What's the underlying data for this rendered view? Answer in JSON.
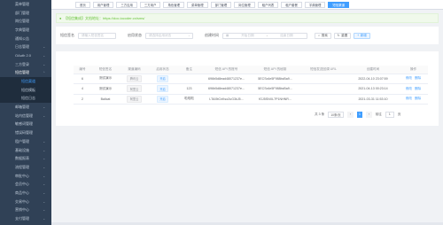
{
  "sidebar": {
    "items": [
      {
        "label": "菜单管理",
        "kind": "item"
      },
      {
        "label": "部门管理",
        "kind": "item"
      },
      {
        "label": "岗位管理",
        "kind": "item"
      },
      {
        "label": "字典管理",
        "kind": "item"
      },
      {
        "label": "通知公告",
        "kind": "item"
      },
      {
        "label": "日志管理",
        "kind": "group"
      },
      {
        "label": "OAuth 2.0",
        "kind": "group"
      },
      {
        "label": "三方登录",
        "kind": "group"
      },
      {
        "label": "短信管理",
        "kind": "group-open"
      },
      {
        "label": "短信渠道",
        "kind": "sub-active"
      },
      {
        "label": "短信模板",
        "kind": "sub"
      },
      {
        "label": "短信日志",
        "kind": "sub"
      },
      {
        "label": "邮箱管理",
        "kind": "group"
      },
      {
        "label": "站内信管理",
        "kind": "group"
      },
      {
        "label": "敏感词管理",
        "kind": "item"
      },
      {
        "label": "错误码管理",
        "kind": "item"
      },
      {
        "label": "租户管理",
        "kind": "group"
      },
      {
        "label": "基础设施",
        "kind": "group"
      },
      {
        "label": "数据报表",
        "kind": "group"
      },
      {
        "label": "流程管理",
        "kind": "group"
      },
      {
        "label": "审批中心",
        "kind": "group"
      },
      {
        "label": "会员中心",
        "kind": "group"
      },
      {
        "label": "商品中心",
        "kind": "group"
      },
      {
        "label": "交易中心",
        "kind": "group"
      },
      {
        "label": "营销中心",
        "kind": "group"
      },
      {
        "label": "支付管理",
        "kind": "group"
      }
    ]
  },
  "tabs": [
    {
      "label": "首页",
      "active": false
    },
    {
      "label": "用户管理",
      "active": false
    },
    {
      "label": "三方应用",
      "active": false
    },
    {
      "label": "三方用户",
      "active": false
    },
    {
      "label": "角色管理",
      "active": false
    },
    {
      "label": "菜单管理",
      "active": false
    },
    {
      "label": "部门管理",
      "active": false
    },
    {
      "label": "岗位管理",
      "active": false
    },
    {
      "label": "租户列表",
      "active": false
    },
    {
      "label": "租户套餐",
      "active": false
    },
    {
      "label": "字典管理",
      "active": false
    },
    {
      "label": "短信渠道",
      "active": true
    }
  ],
  "alert": {
    "text": "【短信集成】文档地址：https://doc.iocoder.cn/sms/"
  },
  "search": {
    "signature_label": "短信签名",
    "signature_placeholder": "请输入短信签名",
    "status_label": "启用状态",
    "status_placeholder": "请选择启用状态",
    "time_label": "创建时间",
    "time_start_placeholder": "开始日期",
    "time_separator": "-",
    "time_end_placeholder": "结束日期",
    "search_button": "搜索",
    "reset_button": "重置",
    "add_button": "新增"
  },
  "table": {
    "headers": [
      "编号",
      "短信签名",
      "渠道编码",
      "启用状态",
      "备注",
      "短信 API 的账号",
      "短信 API 的秘钥",
      "短信发送回调 URL",
      "创建时间",
      "操作"
    ],
    "rows": [
      {
        "id": "6",
        "signature": "测试演示",
        "channel": "腾讯云",
        "status": "开启",
        "remark": "",
        "api_key": "696b5d8ead48071237e...",
        "api_secret": "5ECSx4e5F988bcBa9...",
        "callback": "",
        "created": "2022-04-10 23:07:59"
      },
      {
        "id": "4",
        "signature": "测试演示",
        "channel": "阿里云",
        "status": "开启",
        "remark": "123",
        "api_key": "696b5d8ead48071237e...",
        "api_secret": "5ECSx4e5F988bcBa9...",
        "callback": "",
        "created": "2021-04-13 00:23:14"
      },
      {
        "id": "2",
        "signature": "Ballcat",
        "channel": "阿里云",
        "status": "开启",
        "remark": "啦啦啦",
        "api_key": "LTAI5tCnKso2uG3kJ5...",
        "api_secret": "fGJ5SNXL7P1NHNR...",
        "callback": "",
        "created": "2021-03-31 11:53:10"
      }
    ],
    "actions": {
      "edit": "修改",
      "delete": "删除"
    }
  },
  "pagination": {
    "total": "共 3 条",
    "page_size": "10条/页",
    "prev": "‹",
    "current": "1",
    "next": "›",
    "goto_label": "前往",
    "goto_value": "1",
    "goto_suffix": "页"
  }
}
